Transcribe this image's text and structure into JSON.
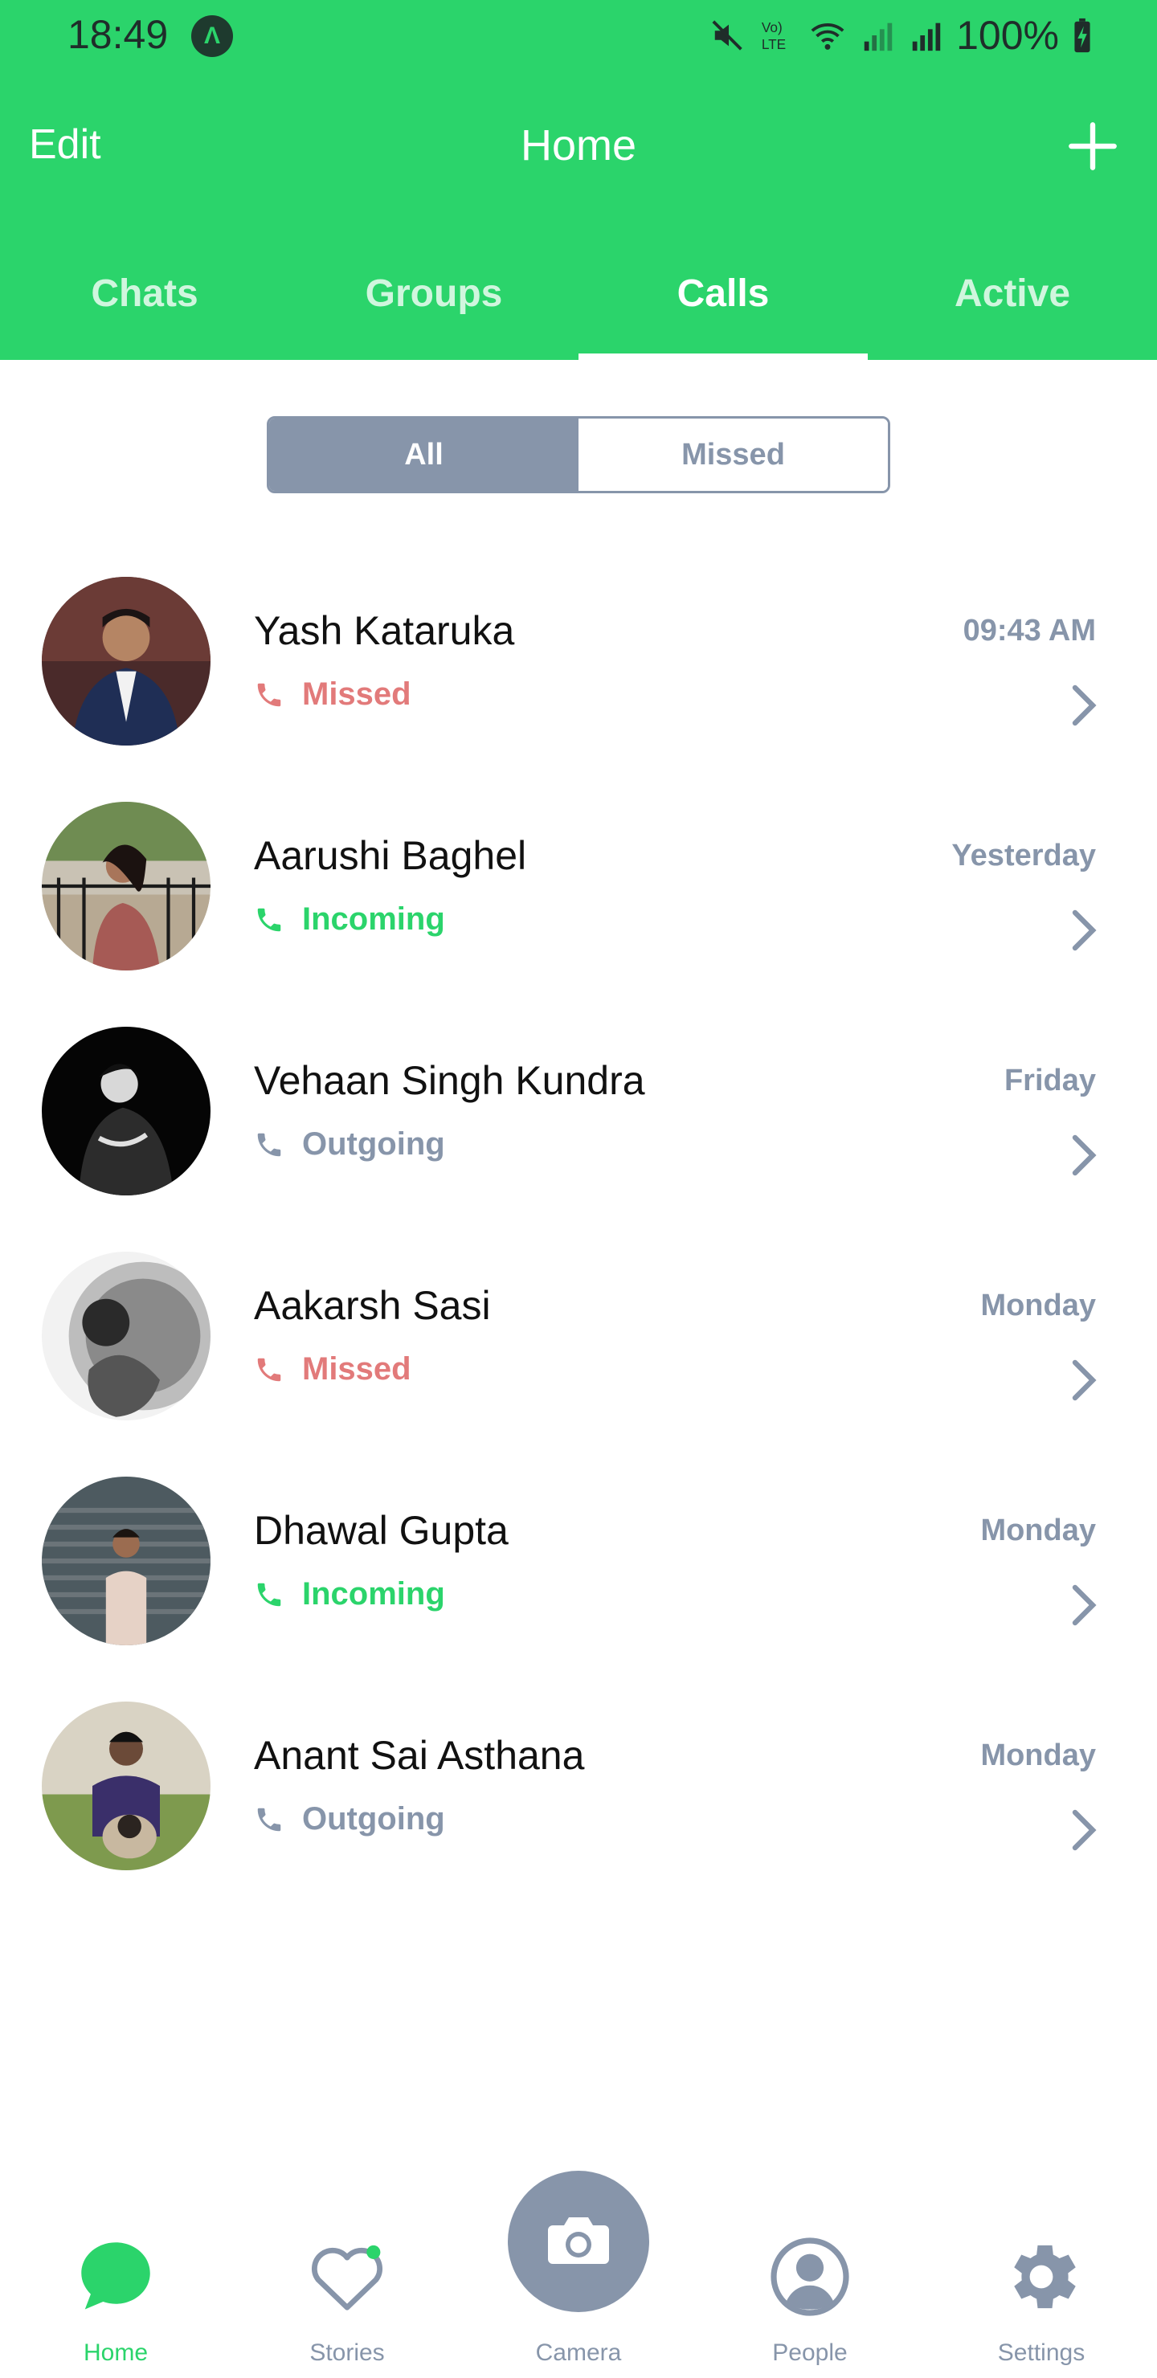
{
  "status_bar": {
    "time": "18:49",
    "battery": "100%"
  },
  "header": {
    "edit_label": "Edit",
    "title": "Home"
  },
  "tabs": [
    {
      "label": "Chats",
      "active": false
    },
    {
      "label": "Groups",
      "active": false
    },
    {
      "label": "Calls",
      "active": true
    },
    {
      "label": "Active",
      "active": false
    }
  ],
  "filter": {
    "all_label": "All",
    "missed_label": "Missed",
    "selected": "All"
  },
  "calls": [
    {
      "name": "Yash Kataruka",
      "status": "Missed",
      "time": "09:43 AM"
    },
    {
      "name": "Aarushi Baghel",
      "status": "Incoming",
      "time": "Yesterday"
    },
    {
      "name": "Vehaan Singh Kundra",
      "status": "Outgoing",
      "time": "Friday"
    },
    {
      "name": "Aakarsh Sasi",
      "status": "Missed",
      "time": "Monday"
    },
    {
      "name": "Dhawal Gupta",
      "status": "Incoming",
      "time": "Monday"
    },
    {
      "name": "Anant Sai Asthana",
      "status": "Outgoing",
      "time": "Monday"
    }
  ],
  "bottom_nav": [
    {
      "label": "Home",
      "icon": "chat-bubble-icon",
      "active": true
    },
    {
      "label": "Stories",
      "icon": "heart-icon",
      "active": false
    },
    {
      "label": "Camera",
      "icon": "camera-icon",
      "active": false
    },
    {
      "label": "People",
      "icon": "person-icon",
      "active": false
    },
    {
      "label": "Settings",
      "icon": "gear-icon",
      "active": false
    }
  ],
  "colors": {
    "brand_green": "#2bd46b",
    "muted_slate": "#8795aa",
    "missed_red": "#e27a7a"
  }
}
